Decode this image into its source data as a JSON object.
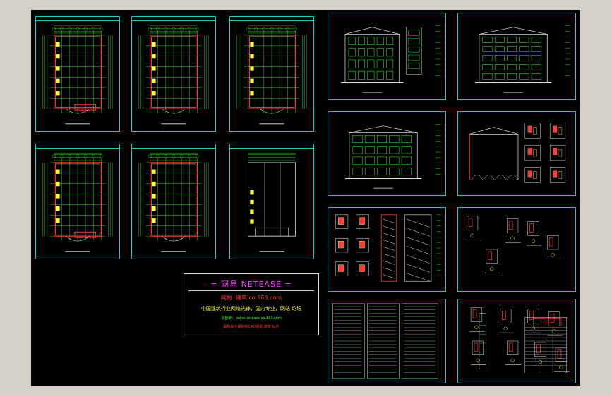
{
  "watermark": {
    "title": "= 网易 NETEASE =",
    "line2": "网易 ·建筑 co.163.com",
    "line3": "中国建筑行业网络先锋，国内专业，网站  论坛",
    "line4": "请登录： www.netease.co.163.com",
    "line5": "最新最全最好的CAD图纸 建筑 设计"
  },
  "colors": {
    "background": "#000000",
    "frame": "#1ec8c8",
    "axis_red": "#ff3c3c",
    "wall_white": "#e6e6e6",
    "dim_green": "#32ff32",
    "fill_yellow": "#ffff32"
  },
  "sheets": [
    {
      "kind": "floor-plan"
    },
    {
      "kind": "floor-plan"
    },
    {
      "kind": "floor-plan"
    },
    {
      "kind": "floor-plan"
    },
    {
      "kind": "floor-plan"
    },
    {
      "kind": "roof-plan"
    },
    {
      "kind": "front-elevation"
    },
    {
      "kind": "side-elevation"
    },
    {
      "kind": "rear-elevation"
    },
    {
      "kind": "section-details"
    },
    {
      "kind": "stair-details"
    },
    {
      "kind": "wall-details"
    },
    {
      "kind": "design-notes"
    },
    {
      "kind": "door-window-details"
    }
  ]
}
